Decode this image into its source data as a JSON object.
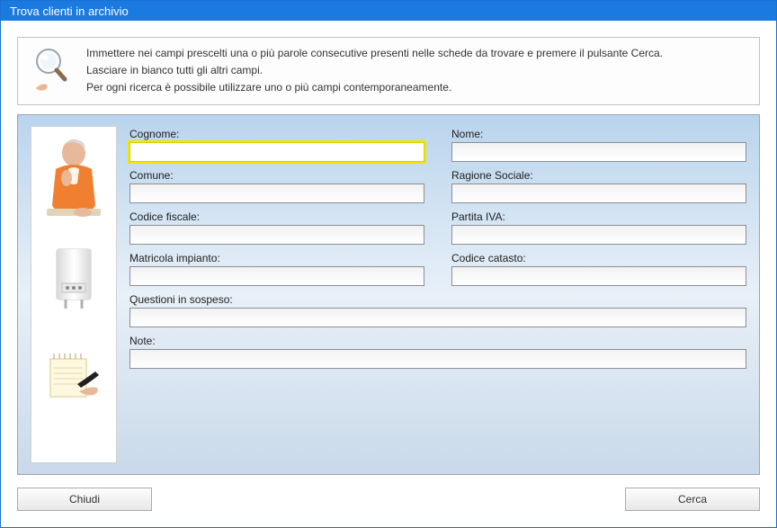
{
  "window": {
    "title": "Trova clienti in archivio"
  },
  "instructions": {
    "line1": "Immettere nei campi prescelti una o più parole consecutive presenti nelle schede da trovare e premere il pulsante Cerca.",
    "line2": "Lasciare in bianco tutti gli altri campi.",
    "line3": "Per ogni ricerca è possibile utilizzare uno o più campi contemporaneamente."
  },
  "fields": {
    "cognome": {
      "label": "Cognome:",
      "value": ""
    },
    "nome": {
      "label": "Nome:",
      "value": ""
    },
    "comune": {
      "label": "Comune:",
      "value": ""
    },
    "ragione_sociale": {
      "label": "Ragione Sociale:",
      "value": ""
    },
    "codice_fiscale": {
      "label": "Codice fiscale:",
      "value": ""
    },
    "partita_iva": {
      "label": "Partita IVA:",
      "value": ""
    },
    "matricola_impianto": {
      "label": "Matricola impianto:",
      "value": ""
    },
    "codice_catasto": {
      "label": "Codice catasto:",
      "value": ""
    },
    "questioni_in_sospeso": {
      "label": "Questioni in sospeso:",
      "value": ""
    },
    "note": {
      "label": "Note:",
      "value": ""
    }
  },
  "buttons": {
    "chiudi": "Chiudi",
    "cerca": "Cerca"
  },
  "sidebar_icons": {
    "person": "person-icon",
    "boiler": "boiler-icon",
    "notes": "notes-icon"
  }
}
